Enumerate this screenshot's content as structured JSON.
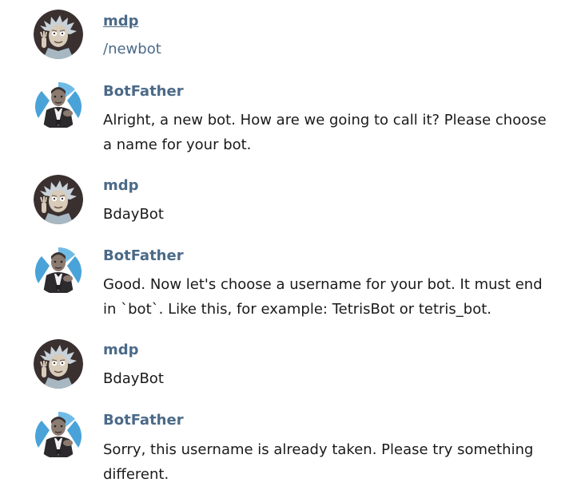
{
  "messages": [
    {
      "sender": "mdp",
      "text": "/newbot",
      "avatar_icon": "rick-avatar-icon"
    },
    {
      "sender": "BotFather",
      "text": "Alright, a new bot. How are we going to call it? Please choose a name for your bot.",
      "avatar_icon": "botfather-avatar-icon"
    },
    {
      "sender": "mdp",
      "text": "BdayBot",
      "avatar_icon": "rick-avatar-icon"
    },
    {
      "sender": "BotFather",
      "text": "Good. Now let's choose a username for your bot. It must end in `bot`. Like this, for example: TetrisBot or tetris_bot.",
      "avatar_icon": "botfather-avatar-icon"
    },
    {
      "sender": "mdp",
      "text": "BdayBot",
      "avatar_icon": "rick-avatar-icon"
    },
    {
      "sender": "BotFather",
      "text": "Sorry, this username is already taken. Please try something different.",
      "avatar_icon": "botfather-avatar-icon"
    }
  ],
  "colors": {
    "sender_name": "#4b6a88",
    "message_text": "#1a1a1a",
    "command_text": "#4b6a88",
    "background": "#ffffff",
    "botfather_avatar_bg": "#4aa3d8",
    "rick_avatar_bg": "#3a3030"
  }
}
